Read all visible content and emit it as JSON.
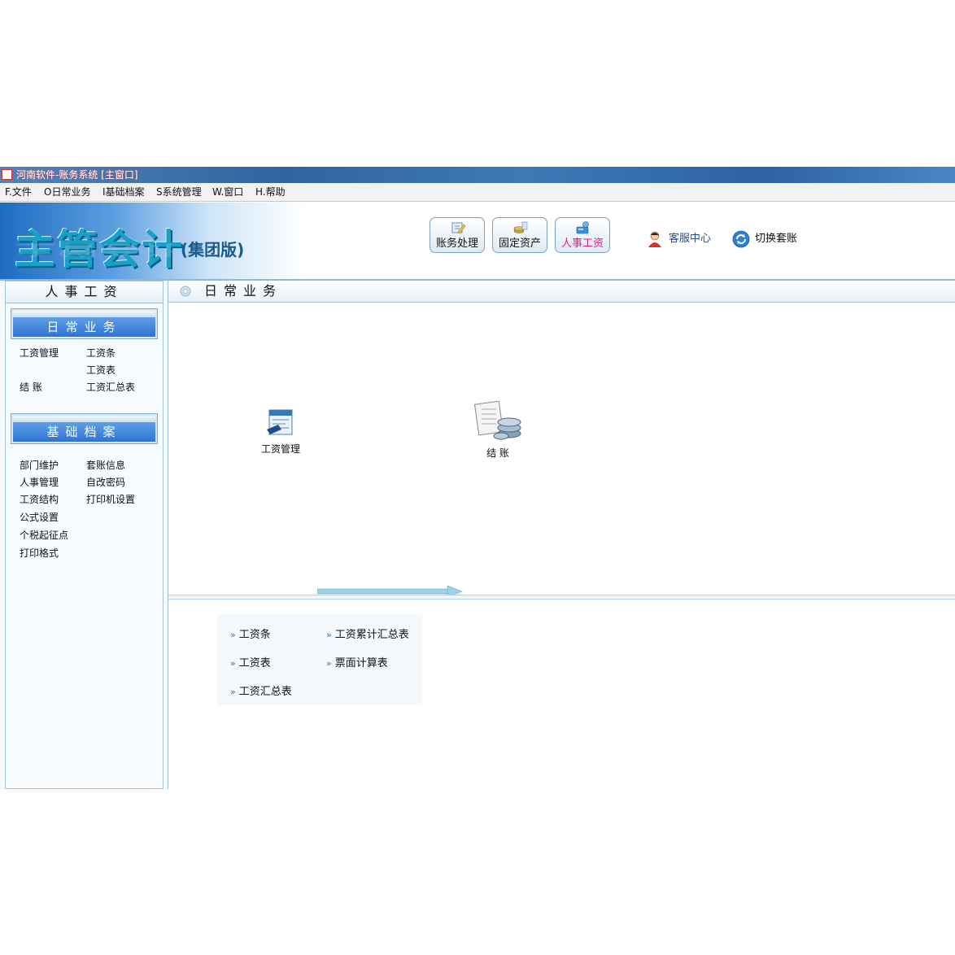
{
  "window": {
    "title": "河南软件-账务系统 [主窗口]"
  },
  "menu": [
    "F.文件",
    "O日常业务",
    "I基础档案",
    "S系统管理",
    "W.窗口",
    "H.帮助"
  ],
  "header": {
    "logo": "主管会计",
    "edition": "(集团版)",
    "modules": [
      {
        "label": "账务处理",
        "icon": "ledger-icon",
        "active": false
      },
      {
        "label": "固定资产",
        "icon": "assets-icon",
        "active": false
      },
      {
        "label": "人事工资",
        "icon": "payroll-icon",
        "active": true
      }
    ],
    "links": [
      {
        "label": "客服中心",
        "icon": "customer-service-icon"
      },
      {
        "label": "切换套账",
        "icon": "switch-account-icon"
      }
    ]
  },
  "sidebar": {
    "title": "人事工资",
    "sections": [
      {
        "title": "日常业务",
        "items": [
          "工资管理",
          "工资条",
          "工资表",
          "结 账",
          "工资汇总表"
        ]
      },
      {
        "title": "基础档案",
        "items": [
          "部门维护",
          "套账信息",
          "人事管理",
          "自改密码",
          "工资结构",
          "打印机设置",
          "公式设置",
          "个税起征点",
          "打印格式"
        ]
      }
    ]
  },
  "main": {
    "title": "日常业务",
    "flow": [
      {
        "label": "工资管理",
        "icon": "payroll-management-icon"
      },
      {
        "label": "结 账",
        "icon": "closing-icon"
      }
    ],
    "reports": [
      "工资条",
      "工资累计汇总表",
      "工资表",
      "票面计算表",
      "工资汇总表"
    ]
  },
  "colors": {
    "accent": "#2f74d4",
    "active_module": "#d3238a",
    "border": "#9fc2de"
  }
}
